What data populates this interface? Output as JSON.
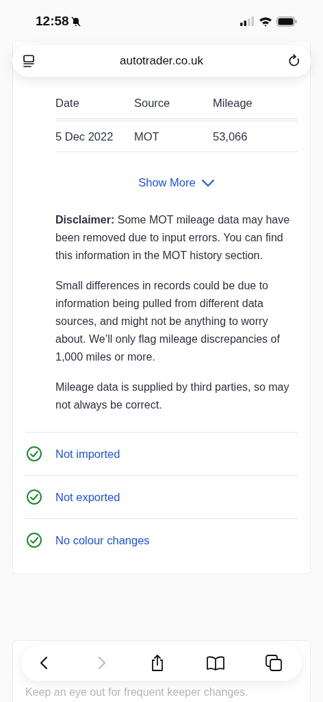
{
  "status_bar": {
    "time": "12:58",
    "silent": true
  },
  "address_bar": {
    "url": "autotrader.co.uk"
  },
  "mileage_table": {
    "columns": [
      "Date",
      "Source",
      "Mileage"
    ],
    "rows": [
      [
        "5 Dec 2022",
        "MOT",
        "53,066"
      ]
    ]
  },
  "show_more": {
    "label": "Show More",
    "expanded": false
  },
  "disclaimer": [
    "**Disclaimer:** Some MOT mileage data may have been removed due to input errors. You can find this information in the MOT history section.",
    "Small differences in records could be due to information being pulled from different data sources, and might not be anything to worry about. We’ll only flag mileage discrepancies of 1,000 miles or more.",
    "Mileage data is supplied by third parties, so may not always be correct."
  ],
  "checks": [
    {
      "label": "Not imported",
      "passed": true
    },
    {
      "label": "Not exported",
      "passed": true
    },
    {
      "label": "No colour changes",
      "passed": true
    }
  ],
  "next_section": {
    "subtitle": "Keep an eye out for frequent keeper changes."
  },
  "toolbar": {
    "back_disabled": false,
    "forward_disabled": true
  }
}
